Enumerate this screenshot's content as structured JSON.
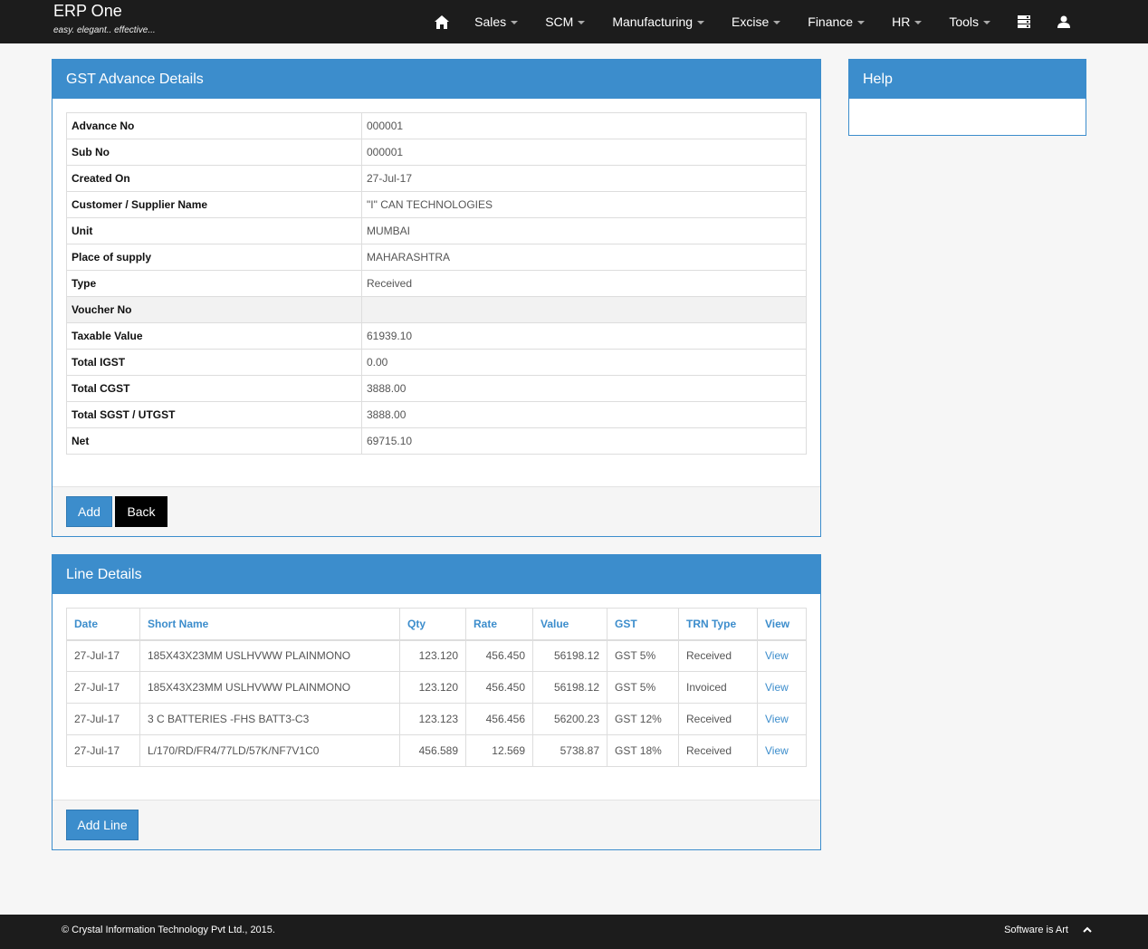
{
  "brand": {
    "title": "ERP One",
    "tagline": "easy. elegant.. effective..."
  },
  "nav": {
    "items": [
      {
        "label": "Sales"
      },
      {
        "label": "SCM"
      },
      {
        "label": "Manufacturing"
      },
      {
        "label": "Excise"
      },
      {
        "label": "Finance"
      },
      {
        "label": "HR"
      },
      {
        "label": "Tools"
      }
    ],
    "icons": [
      "home-icon",
      "server-icon",
      "user-icon"
    ]
  },
  "advance_panel": {
    "title": "GST Advance Details",
    "rows": [
      {
        "label": "Advance No",
        "value": "000001"
      },
      {
        "label": "Sub No",
        "value": "000001"
      },
      {
        "label": "Created On",
        "value": "27-Jul-17"
      },
      {
        "label": "Customer / Supplier Name",
        "value": "\"I\" CAN TECHNOLOGIES"
      },
      {
        "label": "Unit",
        "value": "MUMBAI"
      },
      {
        "label": "Place of supply",
        "value": "MAHARASHTRA"
      },
      {
        "label": "Type",
        "value": "Received"
      },
      {
        "label": "Voucher No",
        "value": ""
      },
      {
        "label": "Taxable Value",
        "value": "61939.10"
      },
      {
        "label": "Total IGST",
        "value": "0.00"
      },
      {
        "label": "Total CGST",
        "value": "3888.00"
      },
      {
        "label": "Total SGST / UTGST",
        "value": "3888.00"
      },
      {
        "label": "Net",
        "value": "69715.10"
      }
    ],
    "add_label": "Add",
    "back_label": "Back"
  },
  "help_panel": {
    "title": "Help"
  },
  "line_panel": {
    "title": "Line Details",
    "columns": [
      "Date",
      "Short Name",
      "Qty",
      "Rate",
      "Value",
      "GST",
      "TRN Type",
      "View"
    ],
    "rows": [
      {
        "date": "27-Jul-17",
        "short_name": "185X43X23MM USLHVWW PLAINMONO",
        "qty": "123.120",
        "rate": "456.450",
        "value": "56198.12",
        "gst": "GST 5%",
        "trn_type": "Received",
        "view": "View"
      },
      {
        "date": "27-Jul-17",
        "short_name": "185X43X23MM USLHVWW PLAINMONO",
        "qty": "123.120",
        "rate": "456.450",
        "value": "56198.12",
        "gst": "GST 5%",
        "trn_type": "Invoiced",
        "view": "View"
      },
      {
        "date": "27-Jul-17",
        "short_name": "3 C BATTERIES -FHS BATT3-C3",
        "qty": "123.123",
        "rate": "456.456",
        "value": "56200.23",
        "gst": "GST 12%",
        "trn_type": "Received",
        "view": "View"
      },
      {
        "date": "27-Jul-17",
        "short_name": "L/170/RD/FR4/77LD/57K/NF7V1C0",
        "qty": "456.589",
        "rate": "12.569",
        "value": "5738.87",
        "gst": "GST 18%",
        "trn_type": "Received",
        "view": "View"
      }
    ],
    "add_line_label": "Add Line"
  },
  "footer": {
    "copyright": "© Crystal Information Technology Pvt Ltd., 2015.",
    "tagline": "Software is Art"
  }
}
